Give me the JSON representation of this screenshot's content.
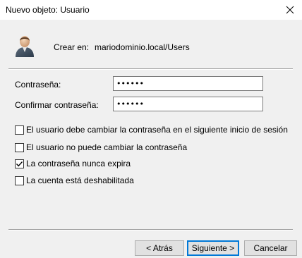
{
  "window": {
    "title": "Nuevo objeto: Usuario"
  },
  "header": {
    "create_in_label": "Crear en:",
    "create_in_path": "mariodominio.local/Users"
  },
  "form": {
    "password_label": "Contraseña:",
    "password_value": "••••••",
    "confirm_label": "Confirmar contraseña:",
    "confirm_value": "••••••"
  },
  "options": [
    {
      "label": "El usuario debe cambiar la contraseña en el siguiente inicio de sesión",
      "checked": false
    },
    {
      "label": "El usuario no puede cambiar la contraseña",
      "checked": false
    },
    {
      "label": "La contraseña nunca expira",
      "checked": true
    },
    {
      "label": "La cuenta está deshabilitada",
      "checked": false
    }
  ],
  "buttons": {
    "back": "< Atrás",
    "next": "Siguiente >",
    "cancel": "Cancelar"
  }
}
